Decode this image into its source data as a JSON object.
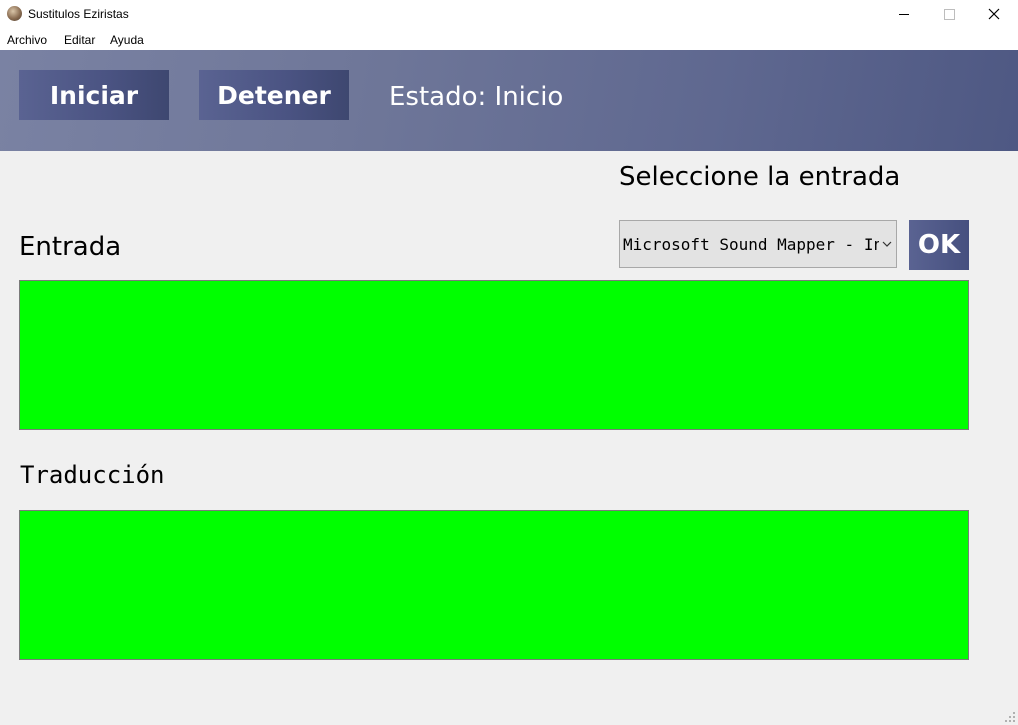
{
  "window": {
    "title": "Sustitulos Eziristas",
    "app_icon": "app-logo-icon",
    "controls": [
      "minimize-icon",
      "maximize-icon",
      "close-icon"
    ]
  },
  "menu": {
    "items": [
      {
        "label": "Archivo"
      },
      {
        "label": "Editar"
      },
      {
        "label": "Ayuda"
      }
    ]
  },
  "toolbar": {
    "start_label": "Iniciar",
    "stop_label": "Detener",
    "status_text": "Estado: Inicio"
  },
  "input_select": {
    "label": "Seleccione la entrada",
    "selected_value": "Microsoft Sound Mapper - Input",
    "confirm_label": "OK"
  },
  "panels": {
    "input_label": "Entrada",
    "input_text": "",
    "translation_label": "Traducción",
    "translation_text": ""
  },
  "colors": {
    "header_gradient_start": "#7a82a3",
    "header_gradient_end": "#4e5883",
    "button_bg": "#4a5382",
    "text_box_bg": "#00ff00",
    "window_bg": "#f0f0f0"
  }
}
